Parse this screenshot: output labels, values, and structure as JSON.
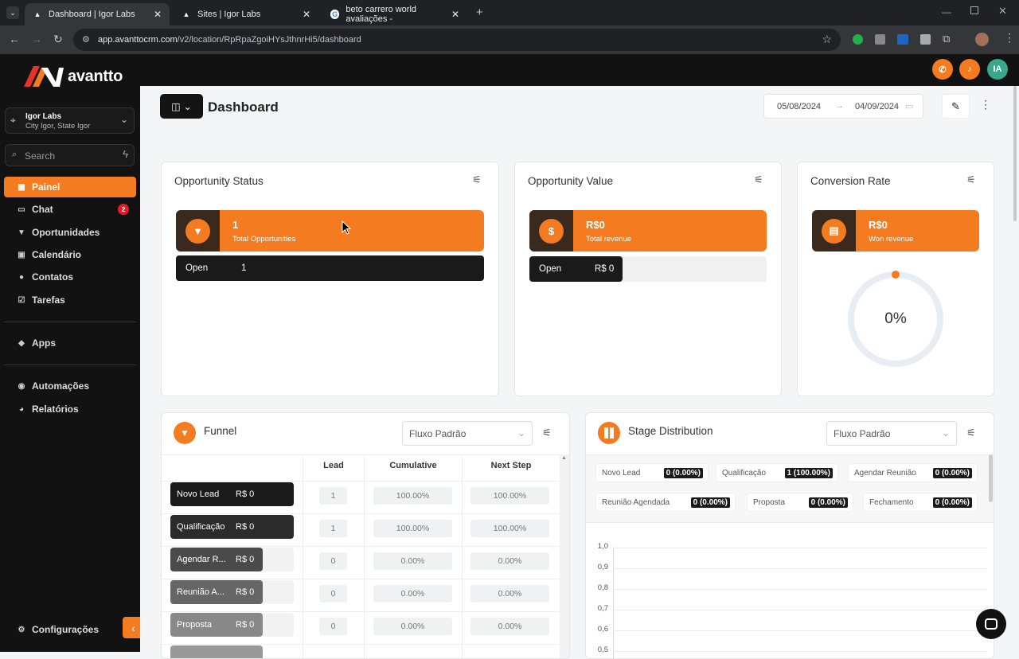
{
  "browser": {
    "tabs": [
      {
        "title": "Dashboard | Igor Labs"
      },
      {
        "title": "Sites | Igor Labs"
      },
      {
        "title": "beto carrero world avaliações -"
      }
    ],
    "url_host": "app.avanttocrm.com",
    "url_path": "/v2/location/RpRpaZgoiHYsJthnrHi5/dashboard"
  },
  "sidebar": {
    "brand": "avantto",
    "location_name": "Igor Labs",
    "location_sub": "City Igor, State Igor",
    "search_placeholder": "Search",
    "items": [
      {
        "label": "Painel",
        "icon": "dashboard-icon"
      },
      {
        "label": "Chat",
        "icon": "chat-icon",
        "badge": "2"
      },
      {
        "label": "Oportunidades",
        "icon": "funnel-icon"
      },
      {
        "label": "Calendário",
        "icon": "calendar-icon"
      },
      {
        "label": "Contatos",
        "icon": "contact-icon"
      },
      {
        "label": "Tarefas",
        "icon": "task-icon"
      },
      {
        "label": "Apps",
        "icon": "apps-icon"
      },
      {
        "label": "Automações",
        "icon": "automation-icon"
      },
      {
        "label": "Relatórios",
        "icon": "report-icon"
      }
    ],
    "settings_label": "Configurações"
  },
  "topbar": {
    "avatar_initials": "IA"
  },
  "header": {
    "title": "Dashboard",
    "date_from": "05/08/2024",
    "date_to": "04/09/2024"
  },
  "opportunity_status": {
    "title": "Opportunity Status",
    "value": "1",
    "label": "Total Opportunities",
    "row_label": "Open",
    "row_value": "1"
  },
  "opportunity_value": {
    "title": "Opportunity Value",
    "value": "R$0",
    "label": "Total revenue",
    "row_label": "Open",
    "row_value": "R$ 0"
  },
  "conversion_rate": {
    "title": "Conversion Rate",
    "value": "R$0",
    "label": "Won revenue",
    "gauge_text": "0%",
    "gauge_fraction": 0
  },
  "funnel": {
    "title": "Funnel",
    "select_value": "Fluxo Padrão",
    "columns": [
      "Lead",
      "Cumulative",
      "Next Step"
    ],
    "rows": [
      {
        "stage": "Novo Lead",
        "value": "R$ 0",
        "lead": "1",
        "cumulative": "100.00%",
        "next": "100.00%"
      },
      {
        "stage": "Qualificação",
        "value": "R$ 0",
        "lead": "1",
        "cumulative": "100.00%",
        "next": "100.00%"
      },
      {
        "stage": "Agendar R...",
        "value": "R$ 0",
        "lead": "0",
        "cumulative": "0.00%",
        "next": "0.00%"
      },
      {
        "stage": "Reunião A...",
        "value": "R$ 0",
        "lead": "0",
        "cumulative": "0.00%",
        "next": "0.00%"
      },
      {
        "stage": "Proposta",
        "value": "R$ 0",
        "lead": "0",
        "cumulative": "0.00%",
        "next": "0.00%"
      }
    ]
  },
  "stage_distribution": {
    "title": "Stage Distribution",
    "select_value": "Fluxo Padrão",
    "chips": [
      {
        "label": "Novo Lead",
        "value": "0 (0.00%)"
      },
      {
        "label": "Qualificação",
        "value": "1 (100.00%)"
      },
      {
        "label": "Agendar Reunião",
        "value": "0 (0.00%)"
      },
      {
        "label": "Reunião Agendada",
        "value": "0 (0.00%)"
      },
      {
        "label": "Proposta",
        "value": "0 (0.00%)"
      },
      {
        "label": "Fechamento",
        "value": "0 (0.00%)"
      }
    ],
    "y_ticks": [
      "1,0",
      "0,9",
      "0,8",
      "0,7",
      "0,6",
      "0,5"
    ]
  }
}
